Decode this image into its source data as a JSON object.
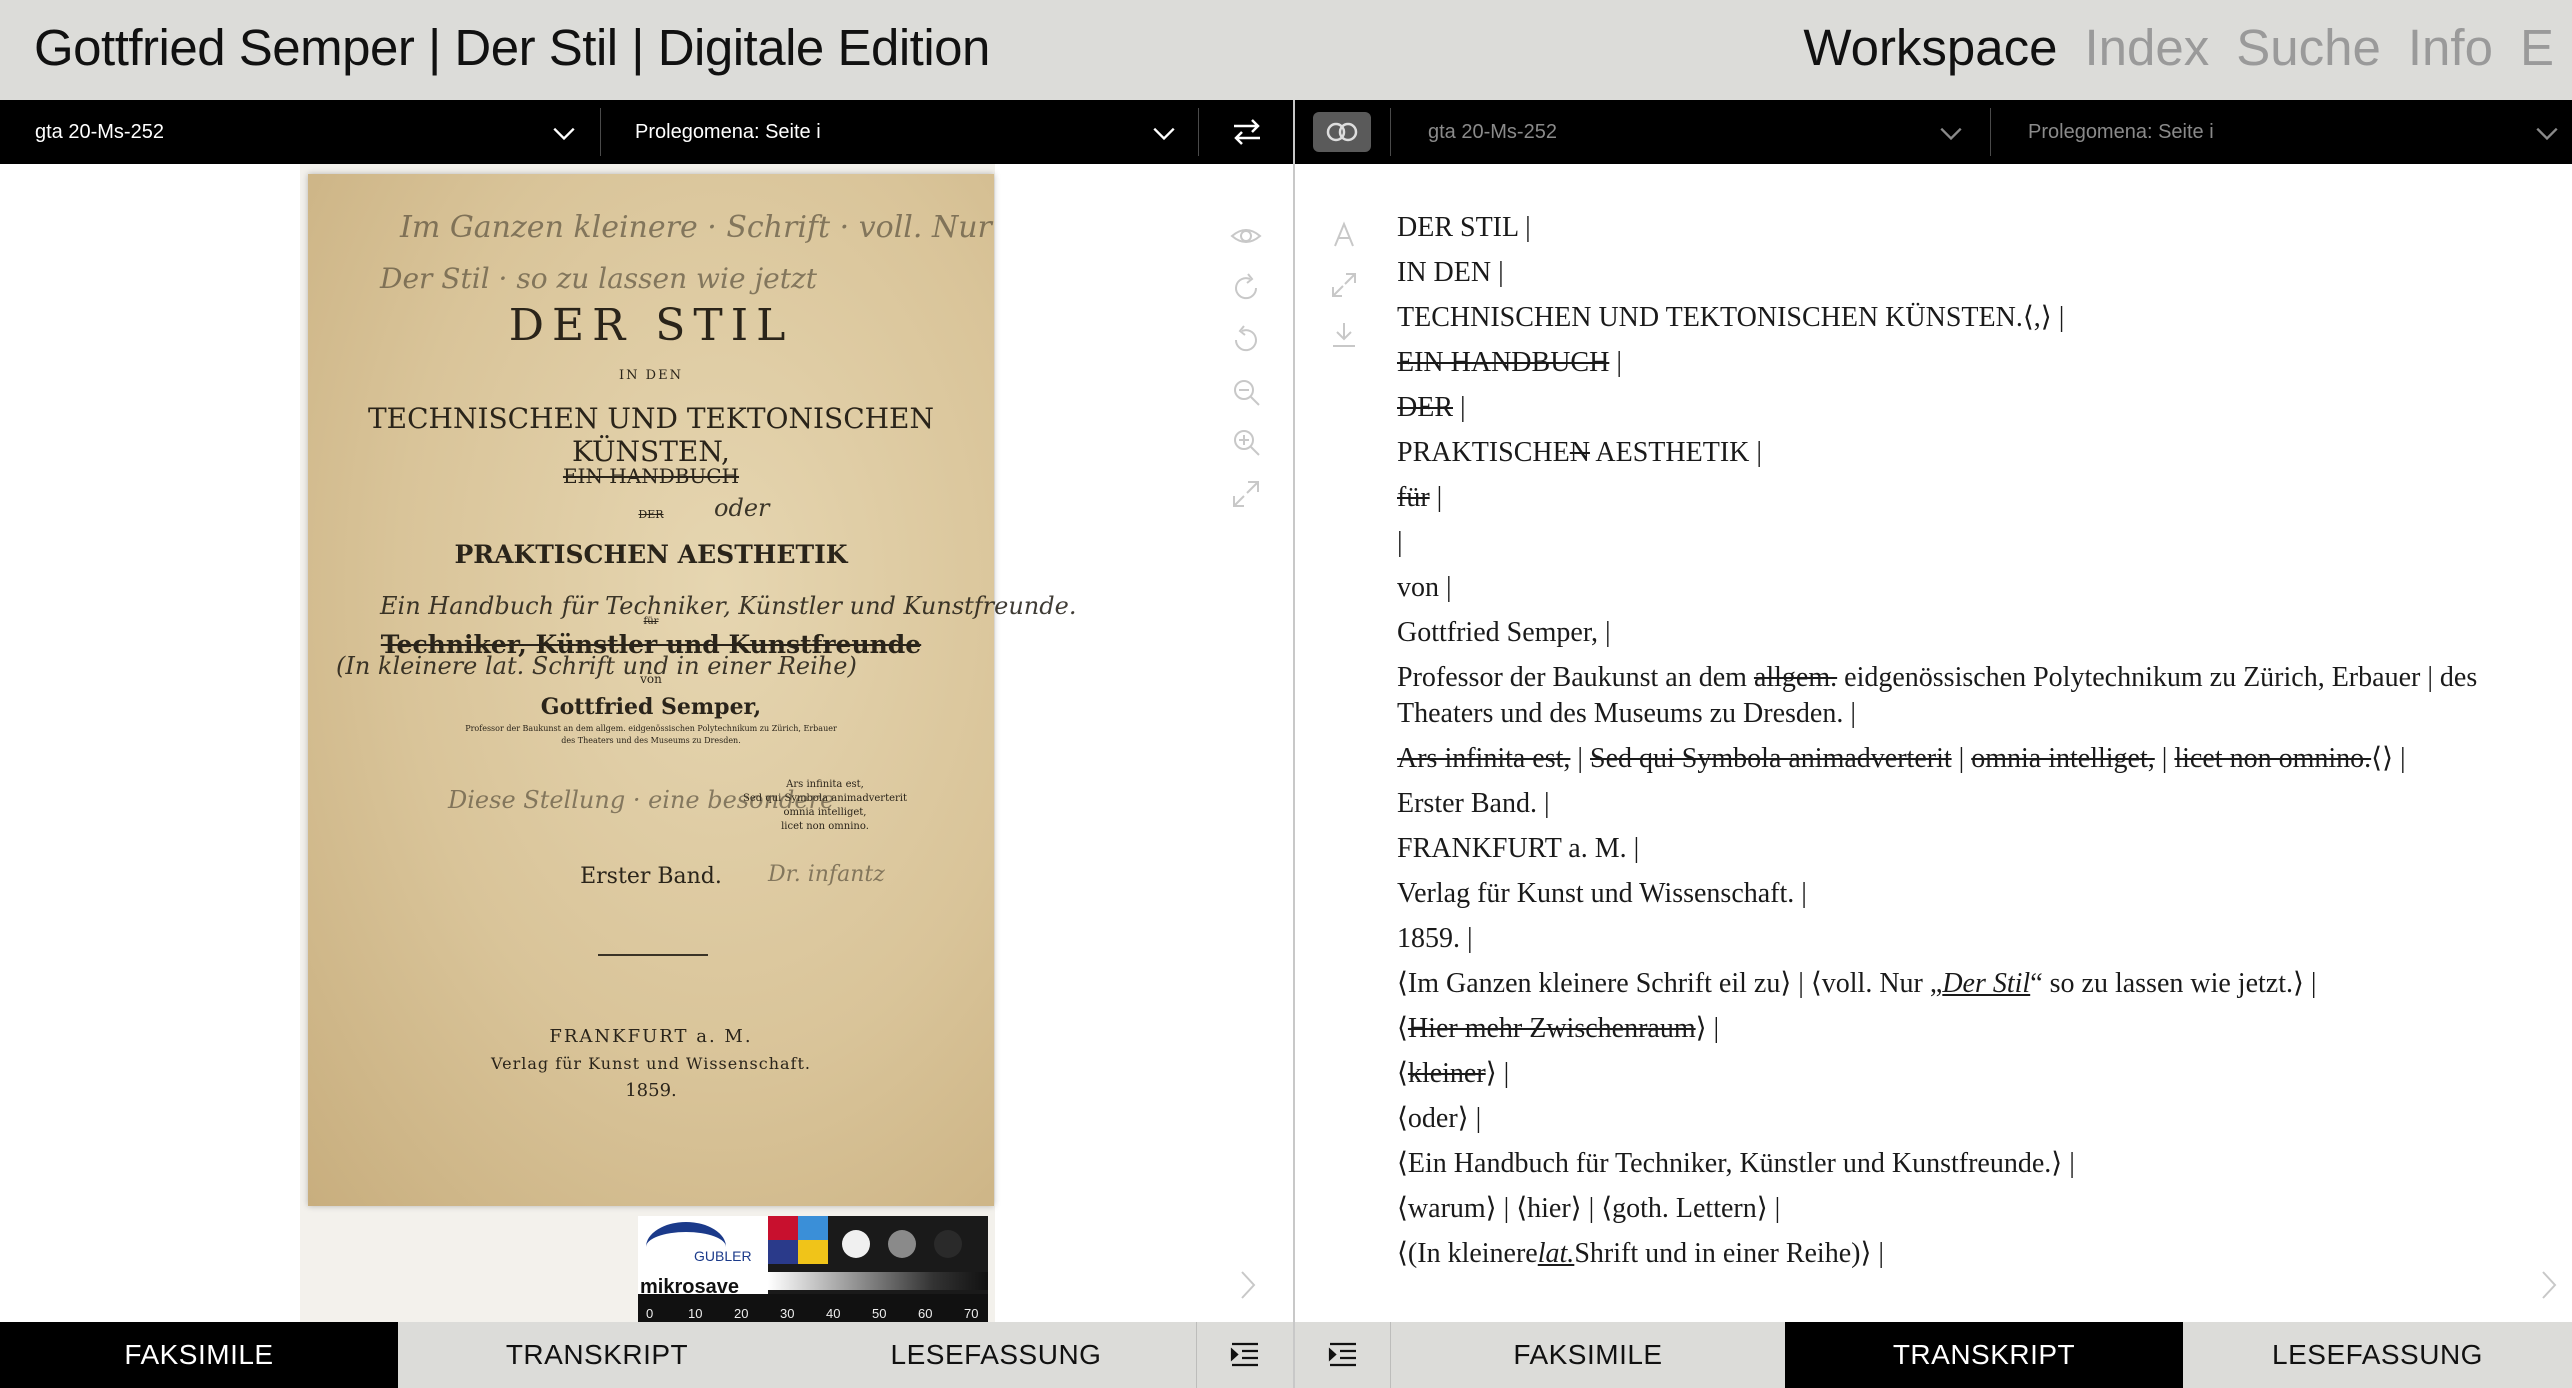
{
  "header": {
    "title": "Gottfried Semper | Der Stil | Digitale Edition",
    "nav": [
      "Workspace",
      "Index",
      "Suche",
      "Info",
      "E"
    ],
    "active_nav": "Workspace"
  },
  "left_bar": {
    "manuscript": "gta 20-Ms-252",
    "page": "Prolegomena: Seite i"
  },
  "right_bar": {
    "manuscript": "gta 20-Ms-252",
    "page": "Prolegomena: Seite i"
  },
  "facsimile": {
    "title": "DER STIL",
    "in_den": "IN DEN",
    "subtitle": "TECHNISCHEN UND TEKTONISCHEN KÜNSTEN,",
    "handbuch": "EIN HANDBUCH",
    "der": "DER",
    "aesthetik": "PRAKTISCHEN AESTHETIK",
    "fuer": "für",
    "techniker": "Techniker, Künstler und Kunstfreunde",
    "von": "von",
    "author": "Gottfried Semper,",
    "prof": "Professor der Baukunst an dem allgem. eidgenössischen Polytechnikum zu Zürich, Erbauer",
    "prof2": "des Theaters und des Museums zu Dresden.",
    "motto": [
      "Ars infinita est,",
      "Sed qui Symbola animadverterit",
      "omnia intelliget,",
      "licet non omnino."
    ],
    "band": "Erster Band.",
    "city": "FRANKFURT a. M.",
    "publisher": "Verlag für Kunst und Wissenschaft.",
    "year": "1859.",
    "chart_logo": "mikrosave",
    "chart_brand": "GUBLER",
    "ruler": [
      "0",
      "10",
      "20",
      "30",
      "40",
      "50",
      "60",
      "70"
    ]
  },
  "transcript": {
    "lines": [
      {
        "parts": [
          {
            "t": "DER STIL",
            "s": "em"
          },
          {
            "t": " |"
          }
        ]
      },
      {
        "parts": [
          {
            "t": "IN DEN |"
          }
        ]
      },
      {
        "parts": [
          {
            "t": "TECHNISCHEN UND TEKTONISCHEN KÜNSTEN.⟨,⟩ |"
          }
        ]
      },
      {
        "parts": [
          {
            "t": "EIN HANDBUCH",
            "s": "st"
          },
          {
            "t": " |"
          }
        ]
      },
      {
        "parts": [
          {
            "t": "DER",
            "s": "st"
          },
          {
            "t": " |"
          }
        ]
      },
      {
        "parts": [
          {
            "t": "PRAKTISCHE",
            "s": "em"
          },
          {
            "t": "N",
            "s": "em st"
          },
          {
            "t": " AESTHETIK",
            "s": "em"
          },
          {
            "t": " |"
          }
        ]
      },
      {
        "parts": [
          {
            "t": "für",
            "s": "st"
          },
          {
            "t": " |"
          }
        ]
      },
      {
        "parts": [
          {
            "t": "|"
          }
        ]
      },
      {
        "parts": [
          {
            "t": "von |"
          }
        ]
      },
      {
        "parts": [
          {
            "t": "Gottfried Semper,",
            "s": "em"
          },
          {
            "t": " |"
          }
        ]
      },
      {
        "parts": [
          {
            "t": "Professor der Baukunst an dem "
          },
          {
            "t": "allgem.",
            "s": "st"
          },
          {
            "t": " eidgenössischen Polytechnikum zu Zürich, Erbauer | des Theaters und des Museums zu Dresden. |"
          }
        ]
      },
      {
        "parts": [
          {
            "t": "Ars infinita est,",
            "s": "st"
          },
          {
            "t": " | "
          },
          {
            "t": "Sed qui Symbola animadverterit",
            "s": "st"
          },
          {
            "t": " | "
          },
          {
            "t": "omnia intelliget,",
            "s": "st"
          },
          {
            "t": " | "
          },
          {
            "t": "licet non omnino.",
            "s": "st"
          },
          {
            "t": "⟨⟩ |"
          }
        ]
      },
      {
        "parts": [
          {
            "t": "Erster Band.",
            "s": "em"
          },
          {
            "t": " |"
          }
        ]
      },
      {
        "parts": [
          {
            "t": "FRANKFURT a. M. |"
          }
        ]
      },
      {
        "parts": [
          {
            "t": "Verlag für Kunst und Wissenschaft.",
            "s": "em"
          },
          {
            "t": " |"
          }
        ]
      },
      {
        "parts": [
          {
            "t": "1859. |"
          }
        ]
      },
      {
        "parts": [
          {
            "t": "⟨Im Ganzen kleinere Schrift eil zu⟩ | ⟨voll. Nur „"
          },
          {
            "t": "Der Stil",
            "s": "ul"
          },
          {
            "t": "“ so zu lassen wie jetzt.⟩ |"
          }
        ]
      },
      {
        "parts": [
          {
            "t": "⟨"
          },
          {
            "t": "Hier mehr Zwischenraum",
            "s": "st"
          },
          {
            "t": "⟩ |"
          }
        ]
      },
      {
        "parts": [
          {
            "t": "⟨"
          },
          {
            "t": "kleiner",
            "s": "st"
          },
          {
            "t": "⟩ |"
          }
        ]
      },
      {
        "parts": [
          {
            "t": "⟨oder⟩ |"
          }
        ]
      },
      {
        "parts": [
          {
            "t": "⟨Ein Handbuch für Techniker, Künstler und Kunstfreunde.⟩ |"
          }
        ]
      },
      {
        "parts": [
          {
            "t": "⟨warum⟩ | ⟨hier⟩ | ⟨goth. Lettern⟩ |"
          }
        ]
      },
      {
        "parts": [
          {
            "t": "⟨(In kleinere"
          },
          {
            "t": "lat.",
            "s": "ul"
          },
          {
            "t": "Shrift und in einer Reihe)⟩ |"
          }
        ]
      }
    ]
  },
  "tabs_left": [
    "FAKSIMILE",
    "TRANSKRIPT",
    "LESEFASSUNG"
  ],
  "tabs_left_active": "FAKSIMILE",
  "tabs_right": [
    "FAKSIMILE",
    "TRANSKRIPT",
    "LESEFASSUNG"
  ],
  "tabs_right_active": "TRANSKRIPT",
  "icons": {
    "swap": "swap-arrows-icon",
    "link": "link-icon",
    "toc": "table-of-contents-icon",
    "next": "chevron-right-icon"
  },
  "colors": {
    "header_bg": "#dcdcd9",
    "bar_bg": "#000000",
    "active_tab_bg": "#000000",
    "inactive_tab_bg": "#dcdcd9",
    "nav_inactive": "#9a9a9a"
  }
}
